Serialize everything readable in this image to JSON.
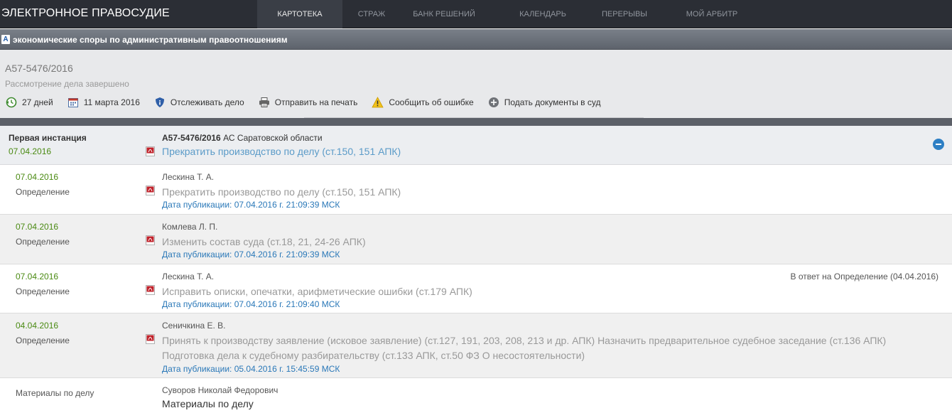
{
  "header": {
    "brand": "ЭЛЕКТРОННОЕ ПРАВОСУДИЕ",
    "nav": [
      "КАРТОТЕКА",
      "СТРАЖ",
      "БАНК РЕШЕНИЙ",
      "КАЛЕНДАРЬ",
      "ПЕРЕРЫВЫ",
      "МОЙ АРБИТР"
    ],
    "active_nav": "КАРТОТЕКА"
  },
  "category": {
    "badge": "А",
    "text": "экономические споры по административным правоотношениям"
  },
  "case": {
    "number": "А57-5476/2016",
    "status": "Рассмотрение дела завершено",
    "actions": {
      "days": "27 дней",
      "date": "11 марта 2016",
      "track": "Отслеживать дело",
      "print": "Отправить на печать",
      "report": "Сообщить об ошибке",
      "submit": "Подать документы в суд"
    }
  },
  "instance": {
    "title": "Первая инстанция",
    "date": "07.04.2016",
    "case_number": "А57-5476/2016",
    "court": "АС Саратовской области",
    "link": "Прекратить производство по делу (ст.150, 151 АПК)"
  },
  "documents": [
    {
      "date": "07.04.2016",
      "type": "Определение",
      "judge": "Лескина Т. А.",
      "title": "Прекратить производство по делу (ст.150, 151 АПК)",
      "published": "Дата публикации: 07.04.2016 г. 21:09:39 МСК",
      "reply": ""
    },
    {
      "date": "07.04.2016",
      "type": "Определение",
      "judge": "Комлева Л. П.",
      "title": "Изменить состав суда (ст.18, 21, 24-26 АПК)",
      "published": "Дата публикации: 07.04.2016 г. 21:09:39 МСК",
      "reply": ""
    },
    {
      "date": "07.04.2016",
      "type": "Определение",
      "judge": "Лескина Т. А.",
      "title": "Исправить описки, опечатки, арифметические ошибки (ст.179 АПК)",
      "published": "Дата публикации: 07.04.2016 г. 21:09:40 МСК",
      "reply": "В ответ на Определение (04.04.2016)"
    },
    {
      "date": "04.04.2016",
      "type": "Определение",
      "judge": "Сеничкина Е. В.",
      "title_line1": "Принять к производству заявление (исковое заявление) (ст.127, 191, 203, 208, 213 и др. АПК) Назначить предварительное судебное заседание (ст.136 АПК)",
      "title_line2": "Подготовка дела к судебному разбирательству (ст.133 АПК, ст.50 ФЗ О несостоятельности)",
      "published": "Дата публикации: 05.04.2016 г. 15:45:59 МСК",
      "reply": ""
    }
  ],
  "materials": {
    "label": "Материалы по делу",
    "person": "Суворов Николай Федорович",
    "title": "Материалы по делу"
  }
}
